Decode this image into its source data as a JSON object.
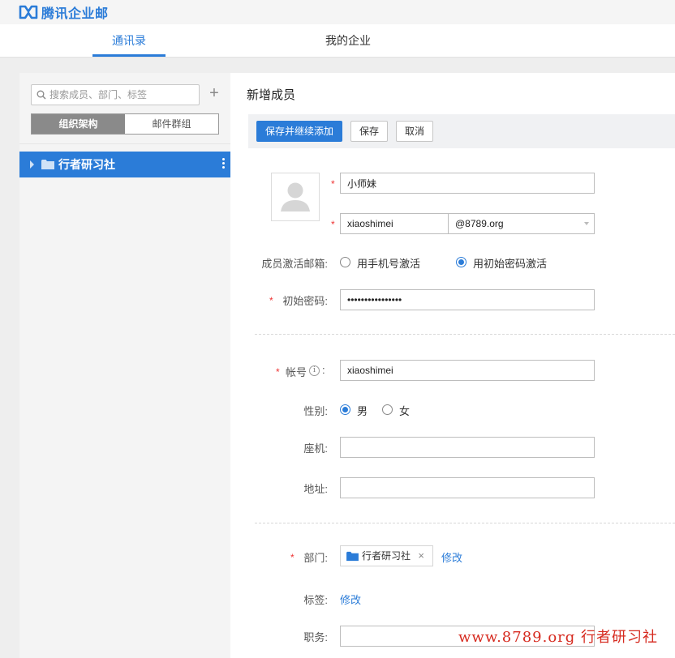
{
  "app": {
    "logo_text": "腾讯企业邮",
    "brand_color": "#2b7cd8"
  },
  "nav": {
    "tabs": [
      {
        "label": "通讯录",
        "active": true
      },
      {
        "label": "我的企业",
        "active": false
      }
    ]
  },
  "sidebar": {
    "search_placeholder": "搜索成员、部门、标签",
    "segments": [
      {
        "label": "组织架构",
        "active": true
      },
      {
        "label": "邮件群组",
        "active": false
      }
    ],
    "tree": [
      {
        "label": "行者研习社",
        "selected": true
      }
    ]
  },
  "main": {
    "title": "新增成员",
    "toolbar": {
      "save_continue": "保存并继续添加",
      "save": "保存",
      "cancel": "取消"
    },
    "form": {
      "name_value": "小师妹",
      "email_local": "xiaoshimei",
      "email_domain": "@8789.org",
      "activation_label": "成员激活邮箱:",
      "activation_options": [
        {
          "label": "用手机号激活",
          "checked": false
        },
        {
          "label": "用初始密码激活",
          "checked": true
        }
      ],
      "password_label": "初始密码:",
      "password_value": "••••••••••••••••",
      "account_label": "帐号",
      "account_colon": ":",
      "account_value": "xiaoshimei",
      "gender_label": "性别:",
      "gender_options": [
        {
          "label": "男",
          "checked": true
        },
        {
          "label": "女",
          "checked": false
        }
      ],
      "phone_label": "座机:",
      "phone_value": "",
      "address_label": "地址:",
      "address_value": "",
      "department_label": "部门:",
      "department_value": "行者研习社",
      "department_edit": "修改",
      "tags_label": "标签:",
      "tags_edit": "修改",
      "position_label": "职务:",
      "position_value": ""
    }
  },
  "watermark": "www.8789.org 行者研习社"
}
